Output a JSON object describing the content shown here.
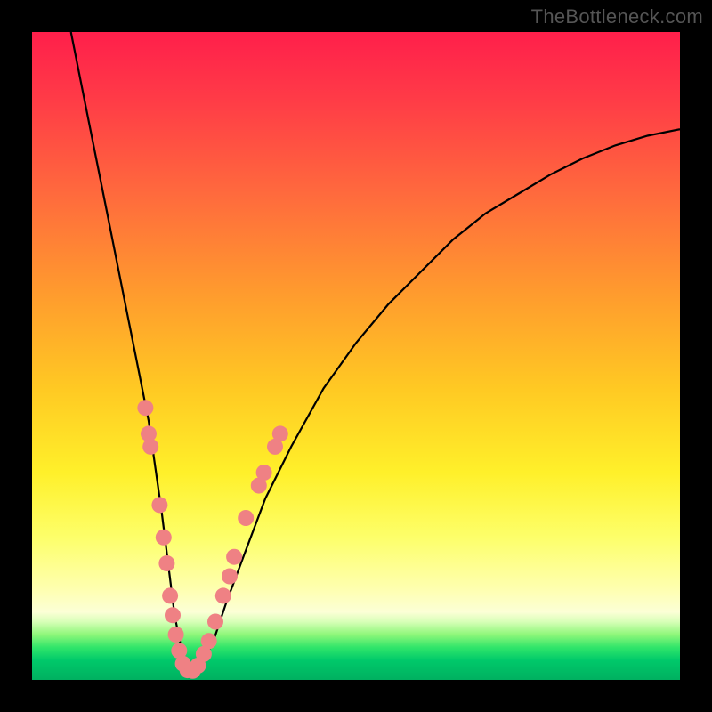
{
  "watermark": "TheBottleneck.com",
  "colors": {
    "frame": "#000000",
    "curve": "#000000",
    "dots": "#ef8184",
    "gradient_top": "#ff1f4b",
    "gradient_bottom": "#00b060"
  },
  "chart_data": {
    "type": "line",
    "title": "",
    "xlabel": "",
    "ylabel": "",
    "xlim": [
      0,
      100
    ],
    "ylim": [
      0,
      100
    ],
    "curve": {
      "x": [
        6,
        8,
        10,
        12,
        14,
        16,
        18,
        19,
        20,
        21,
        22,
        23,
        24,
        26,
        28,
        30,
        33,
        36,
        40,
        45,
        50,
        55,
        60,
        65,
        70,
        75,
        80,
        85,
        90,
        95,
        100
      ],
      "y": [
        100,
        90,
        80,
        70,
        60,
        50,
        40,
        33,
        26,
        18,
        10,
        5,
        2,
        2,
        6,
        12,
        20,
        28,
        36,
        45,
        52,
        58,
        63,
        68,
        72,
        75,
        78,
        80.5,
        82.5,
        84,
        85
      ]
    },
    "series": [
      {
        "name": "markers",
        "points": [
          {
            "x": 17.5,
            "y": 42
          },
          {
            "x": 18.0,
            "y": 38
          },
          {
            "x": 18.3,
            "y": 36
          },
          {
            "x": 19.7,
            "y": 27
          },
          {
            "x": 20.3,
            "y": 22
          },
          {
            "x": 20.8,
            "y": 18
          },
          {
            "x": 21.3,
            "y": 13
          },
          {
            "x": 21.7,
            "y": 10
          },
          {
            "x": 22.2,
            "y": 7
          },
          {
            "x": 22.7,
            "y": 4.5
          },
          {
            "x": 23.3,
            "y": 2.5
          },
          {
            "x": 24.0,
            "y": 1.5
          },
          {
            "x": 24.8,
            "y": 1.4
          },
          {
            "x": 25.6,
            "y": 2.2
          },
          {
            "x": 26.5,
            "y": 4
          },
          {
            "x": 27.3,
            "y": 6
          },
          {
            "x": 28.3,
            "y": 9
          },
          {
            "x": 29.5,
            "y": 13
          },
          {
            "x": 30.5,
            "y": 16
          },
          {
            "x": 31.2,
            "y": 19
          },
          {
            "x": 33.0,
            "y": 25
          },
          {
            "x": 35.0,
            "y": 30
          },
          {
            "x": 35.8,
            "y": 32
          },
          {
            "x": 37.5,
            "y": 36
          },
          {
            "x": 38.3,
            "y": 38
          }
        ]
      }
    ]
  }
}
